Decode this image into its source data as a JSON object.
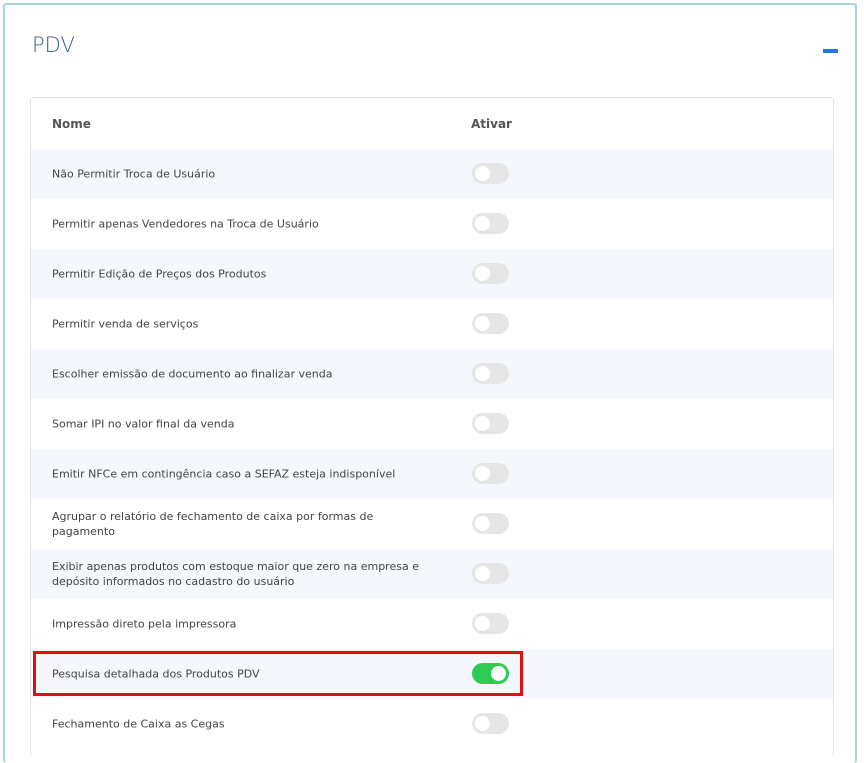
{
  "panel": {
    "title": "PDV"
  },
  "table": {
    "headers": {
      "name": "Nome",
      "activate": "Ativar"
    },
    "rows": [
      {
        "label": "Não Permitir Troca de Usuário",
        "on": false
      },
      {
        "label": "Permitir apenas Vendedores na Troca de Usuário",
        "on": false
      },
      {
        "label": "Permitir Edição de Preços dos Produtos",
        "on": false
      },
      {
        "label": "Permitir venda de serviços",
        "on": false
      },
      {
        "label": "Escolher emissão de documento ao finalizar venda",
        "on": false
      },
      {
        "label": "Somar IPI no valor final da venda",
        "on": false
      },
      {
        "label": "Emitir NFCe em contingência caso a SEFAZ esteja indisponível",
        "on": false
      },
      {
        "label": "Agrupar o relatório de fechamento de caixa por formas de pagamento",
        "on": false
      },
      {
        "label": "Exibir apenas produtos com estoque maior que zero na empresa e depósito informados no cadastro do usuário",
        "on": false
      },
      {
        "label": "Impressão direto pela impressora",
        "on": false
      },
      {
        "label": "Pesquisa detalhada dos Produtos PDV",
        "on": true
      },
      {
        "label": "Fechamento de Caixa as Cegas",
        "on": false
      }
    ]
  }
}
